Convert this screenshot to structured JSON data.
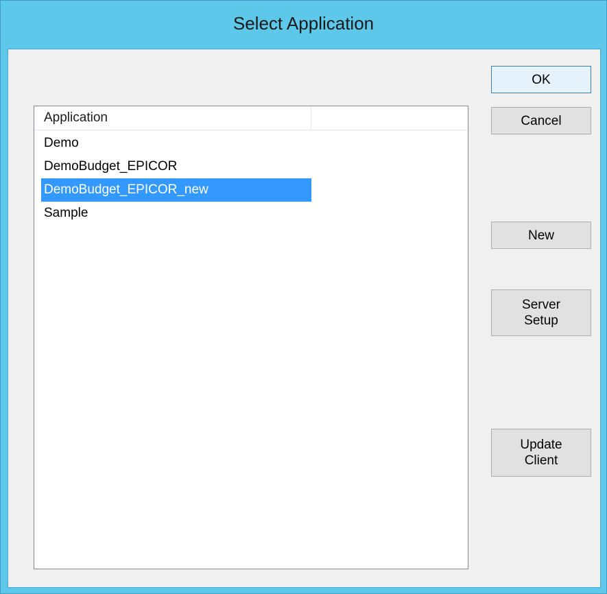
{
  "window": {
    "title": "Select Application"
  },
  "list": {
    "column_header": "Application",
    "items": [
      {
        "label": "Demo",
        "selected": false
      },
      {
        "label": "DemoBudget_EPICOR",
        "selected": false
      },
      {
        "label": "DemoBudget_EPICOR_new",
        "selected": true
      },
      {
        "label": "Sample",
        "selected": false
      }
    ]
  },
  "buttons": {
    "ok": "OK",
    "cancel": "Cancel",
    "new": "New",
    "server_setup": {
      "line1": "Server",
      "line2": "Setup"
    },
    "update_client": {
      "line1": "Update",
      "line2": "Client"
    }
  },
  "colors": {
    "titlebar": "#5ec8ea",
    "selection": "#3399ff",
    "client_bg": "#f0f0f0"
  }
}
